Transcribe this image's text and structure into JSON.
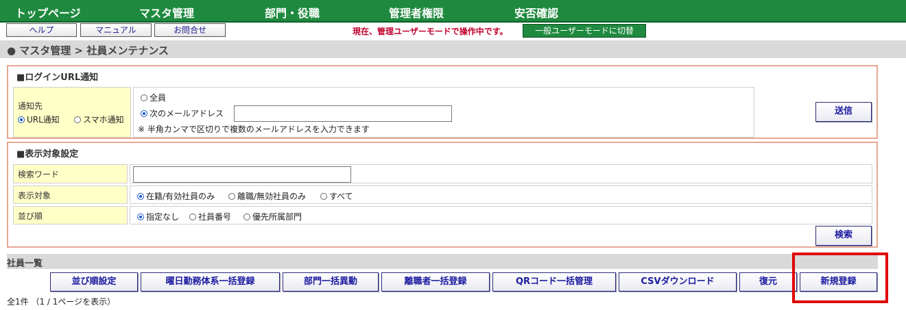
{
  "nav": {
    "items": [
      "トップページ",
      "マスタ管理",
      "部門・役職",
      "管理者権限",
      "安否確認"
    ]
  },
  "toolbar": {
    "help": "ヘルプ",
    "manual": "マニュアル",
    "contact": "お問合せ",
    "mode_message": "現在、管理ユーザーモードで操作中です。",
    "switch_mode": "一般ユーザーモードに切替"
  },
  "breadcrumb": "● マスタ管理 > 社員メンテナンス",
  "login_notice": {
    "title": "■ログインURL通知",
    "target_label": "通知先",
    "type_options": [
      {
        "label": "URL通知",
        "checked": true
      },
      {
        "label": "スマホ通知",
        "checked": false
      }
    ],
    "recipient_options": [
      {
        "label": "全員",
        "checked": false
      },
      {
        "label": "次のメールアドレス",
        "checked": true
      }
    ],
    "email_value": "",
    "note": "※ 半角カンマで区切りで複数のメールアドレスを入力できます",
    "send": "送信"
  },
  "display_settings": {
    "title": "■表示対象設定",
    "keyword_label": "検索ワード",
    "keyword_value": "",
    "target_label": "表示対象",
    "target_options": [
      {
        "label": "在籍/有効社員のみ",
        "checked": true
      },
      {
        "label": "離職/無効社員のみ",
        "checked": false
      },
      {
        "label": "すべて",
        "checked": false
      }
    ],
    "sort_label": "並び順",
    "sort_options": [
      {
        "label": "指定なし",
        "checked": true
      },
      {
        "label": "社員番号",
        "checked": false
      },
      {
        "label": "優先所属部門",
        "checked": false
      }
    ],
    "search": "検索"
  },
  "employee_list": {
    "title": "社員一覧",
    "actions": [
      "並び順設定",
      "曜日勤務体系一括登録",
      "部門一括異動",
      "離職者一括登録",
      "QRコード一括管理",
      "CSVダウンロード",
      "復元",
      "新規登録"
    ],
    "summary": "全1件 （1 / 1ページを表示）"
  },
  "colors": {
    "nav_bg": "#1f8a3f",
    "panel_border": "#e8a792",
    "label_bg": "#ffffc8",
    "highlight": "#e00000",
    "mode_message": "#c0002a"
  }
}
